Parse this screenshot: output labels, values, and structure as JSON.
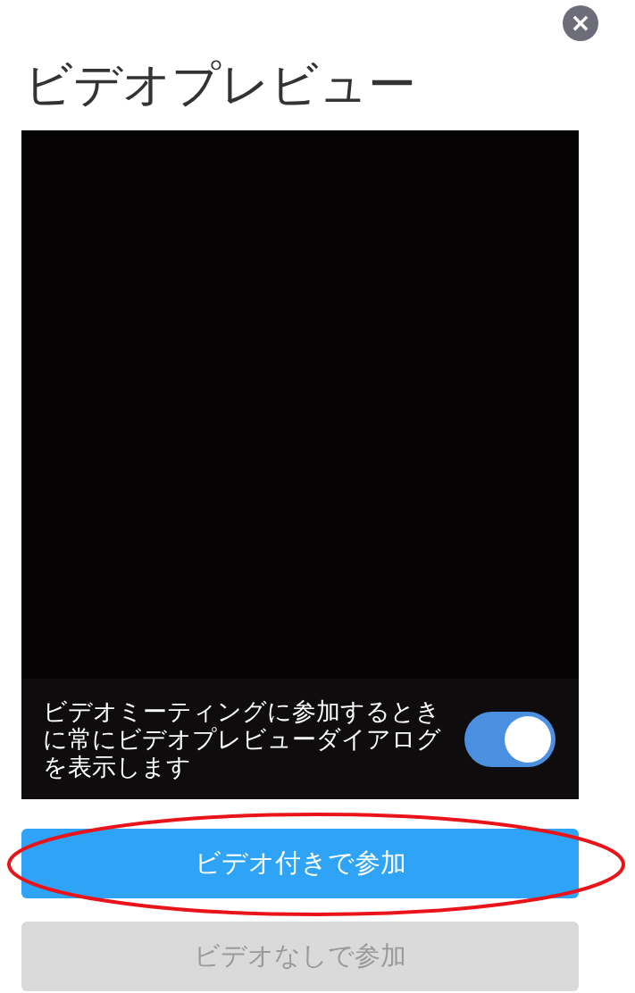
{
  "close_button": {
    "label": "×"
  },
  "title": "ビデオプレビュー",
  "preview": {
    "always_show": {
      "label": "ビデオミーティングに参加するときに常にビデオプレビューダイアログを表示します",
      "on": true
    }
  },
  "buttons": [
    {
      "label": "ビデオ付きで参加",
      "disabled": false
    },
    {
      "label": "ビデオなしで参加",
      "disabled": true
    }
  ],
  "highlight": {
    "kind": "ellipse"
  }
}
